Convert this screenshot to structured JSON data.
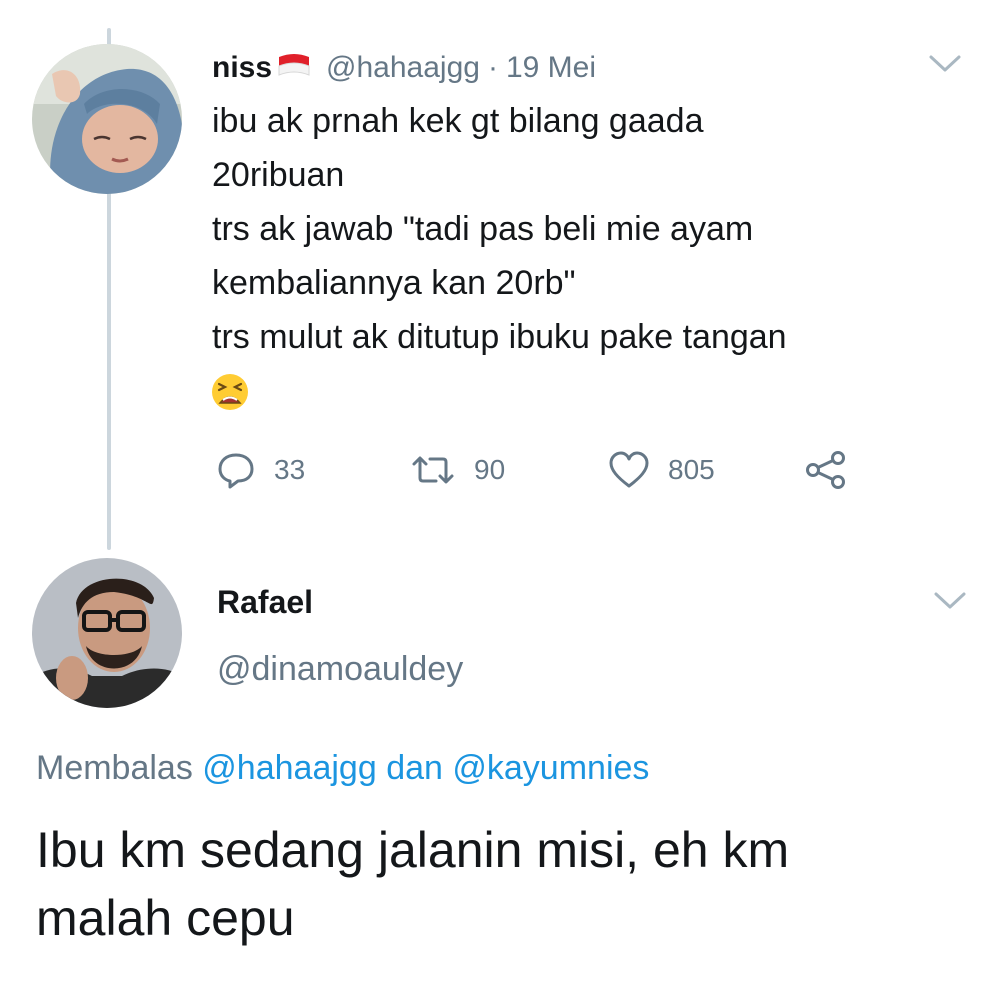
{
  "tweet1": {
    "display_name": "niss",
    "flag_icon": "indonesia-flag-icon",
    "handle": "@hahaajgg",
    "separator": "·",
    "date": "19 Mei",
    "text_lines": [
      "ibu ak prnah kek gt bilang gaada",
      "20ribuan",
      "trs ak jawab \"tadi pas beli mie ayam",
      "kembaliannya kan 20rb\"",
      "trs mulut ak ditutup ibuku pake tangan"
    ],
    "emoji": "tired-face-emoji",
    "reply_count": "33",
    "retweet_count": "90",
    "like_count": "805"
  },
  "tweet2": {
    "display_name": "Rafael",
    "handle": "@dinamoauldey",
    "replying_prefix": "Membalas",
    "replying_user1": "@hahaajgg",
    "replying_conj": "dan",
    "replying_user2": "@kayumnies",
    "text_lines": [
      "Ibu km sedang jalanin misi, eh km",
      "malah cepu"
    ]
  },
  "colors": {
    "text": "#14171a",
    "secondary": "#657786",
    "link": "#1b95e0",
    "thread_line": "#ccd6dd"
  }
}
